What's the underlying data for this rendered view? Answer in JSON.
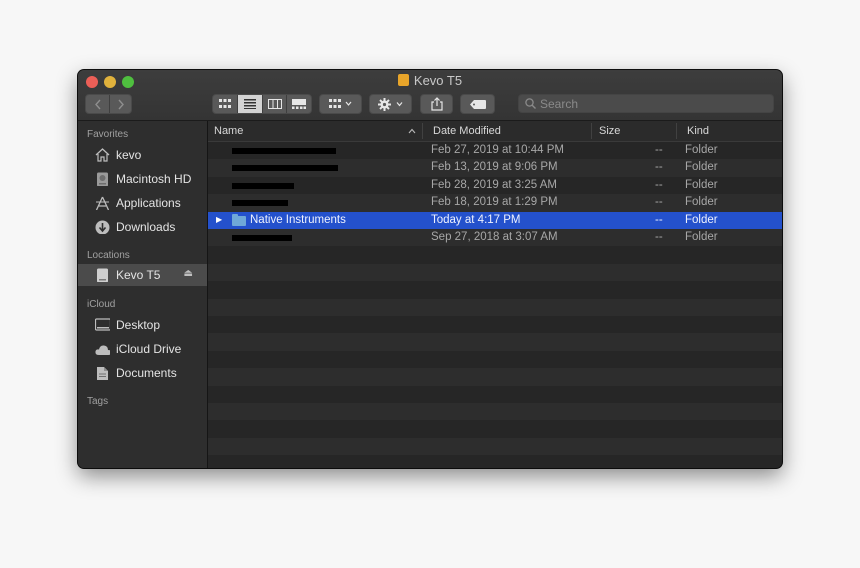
{
  "window": {
    "title": "Kevo T5"
  },
  "toolbar": {
    "search_placeholder": "Search",
    "icons": [
      "chevron-left-icon",
      "chevron-right-icon",
      "icon-view-icon",
      "list-view-icon",
      "column-view-icon",
      "gallery-view-icon",
      "group-icon",
      "gear-icon",
      "share-icon",
      "tag-icon",
      "search-icon"
    ],
    "active_view": "list"
  },
  "sidebar": {
    "favorites_label": "Favorites",
    "favorites": [
      {
        "label": "kevo",
        "icon": "home-icon"
      },
      {
        "label": "Macintosh HD",
        "icon": "harddisk-icon"
      },
      {
        "label": "Applications",
        "icon": "applications-icon"
      },
      {
        "label": "Downloads",
        "icon": "downloads-icon"
      }
    ],
    "locations_label": "Locations",
    "locations": [
      {
        "label": "Kevo T5",
        "icon": "external-drive-icon"
      }
    ],
    "icloud_label": "iCloud",
    "icloud": [
      {
        "label": "Desktop",
        "icon": "desktop-icon"
      },
      {
        "label": "iCloud Drive",
        "icon": "cloud-icon"
      },
      {
        "label": "Documents",
        "icon": "documents-icon"
      }
    ],
    "tags_label": "Tags"
  },
  "columns": {
    "name": "Name",
    "date": "Date Modified",
    "size": "Size",
    "kind": "Kind"
  },
  "rows": [
    {
      "name": "",
      "date": "Feb 27, 2019 at 10:44 PM",
      "size": "--",
      "kind": "Folder",
      "redacted": true
    },
    {
      "name": "",
      "date": "Feb 13, 2019 at 9:06 PM",
      "size": "--",
      "kind": "Folder",
      "redacted": true
    },
    {
      "name": "",
      "date": "Feb 28, 2019 at 3:25 AM",
      "size": "--",
      "kind": "Folder",
      "redacted": true
    },
    {
      "name": "",
      "date": "Feb 18, 2019 at 1:29 PM",
      "size": "--",
      "kind": "Folder",
      "redacted": true
    },
    {
      "name": "Native Instruments",
      "date": "Today at 4:17 PM",
      "size": "--",
      "kind": "Folder",
      "selected": true
    },
    {
      "name": "",
      "date": "Sep 27, 2018 at 3:07 AM",
      "size": "--",
      "kind": "Folder",
      "redacted": true
    }
  ],
  "colors": {
    "selection": "#2451cc",
    "folder": "#6fa8d8",
    "close": "#ec5f57",
    "minimize": "#e1b23c",
    "zoom": "#4fbf3f"
  }
}
